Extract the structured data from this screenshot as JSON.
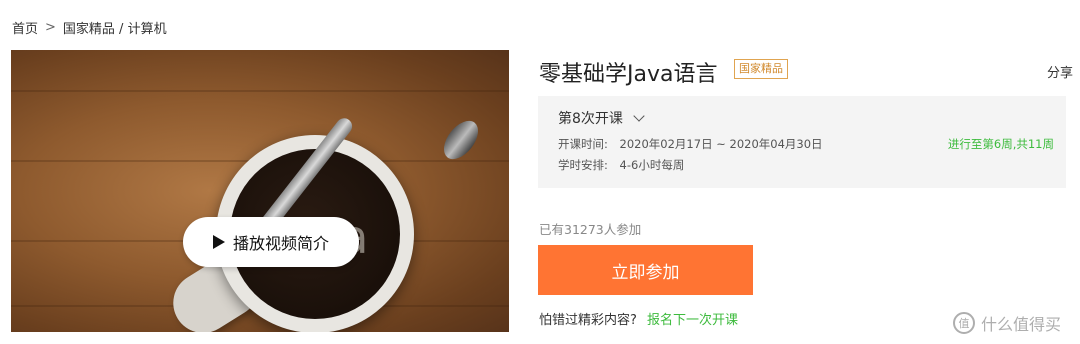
{
  "breadcrumb": {
    "home": "首页",
    "separator": ">",
    "path": "国家精品 / 计算机"
  },
  "video": {
    "play_label": "播放视频简介",
    "image_text": "ba"
  },
  "course": {
    "title": "零基础学Java语言",
    "badge": "国家精品",
    "share": "分享"
  },
  "term": {
    "selected": "第8次开课",
    "start_label": "开课时间:",
    "start_value": "2020年02月17日 ~ 2020年04月30日",
    "schedule_label": "学时安排:",
    "schedule_value": "4-6小时每周",
    "progress": "进行至第6周,共11周"
  },
  "enroll": {
    "count_text": "已有31273人参加",
    "join_label": "立即参加",
    "miss_question": "怕错过精彩内容?",
    "next_link": "报名下一次开课"
  },
  "watermark": {
    "logo_glyph": "值",
    "text": "什么值得买"
  },
  "colors": {
    "accent_orange": "#ff7433",
    "success_green": "#3dbb3d",
    "badge_gold": "#d18a2e"
  }
}
